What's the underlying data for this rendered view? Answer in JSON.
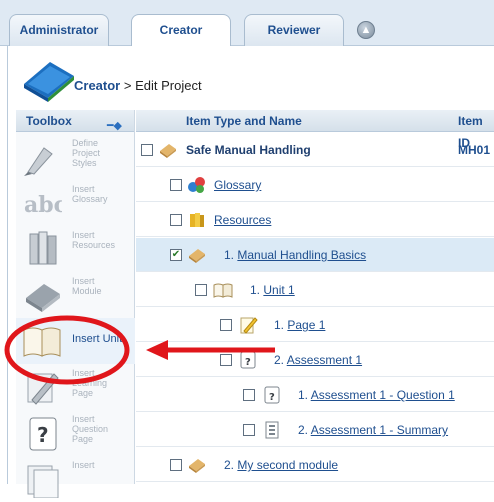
{
  "tabs": [
    {
      "label": "Administrator",
      "active": false
    },
    {
      "label": "Creator",
      "active": true
    },
    {
      "label": "Reviewer",
      "active": false
    }
  ],
  "breadcrumb": {
    "root": "Creator",
    "separator": " > ",
    "page": "Edit Project"
  },
  "toolbox": {
    "title": "Toolbox",
    "tools": [
      {
        "label": "Define Project Styles",
        "icon": "pen-nib-icon",
        "enabled": false
      },
      {
        "label": "Insert Glossary",
        "icon": "abc-glossary-icon",
        "enabled": false
      },
      {
        "label": "Insert Resources",
        "icon": "books-icon",
        "enabled": false
      },
      {
        "label": "Insert Module",
        "icon": "module-book-icon",
        "enabled": false
      },
      {
        "label": "Insert Unit",
        "icon": "open-book-icon",
        "enabled": true
      },
      {
        "label": "Insert Learning Page",
        "icon": "pencil-page-icon",
        "enabled": false
      },
      {
        "label": "Insert Question Page",
        "icon": "question-page-icon",
        "enabled": false
      },
      {
        "label": "Insert",
        "icon": "pages-icon",
        "enabled": false
      }
    ]
  },
  "grid": {
    "headers": {
      "name": "Item Type and Name",
      "id": "Item ID"
    },
    "rows": [
      {
        "name": "Safe Manual Handling",
        "id": "MH01",
        "checked": false,
        "icon": "module-book-icon"
      },
      {
        "name": "Glossary",
        "checked": false,
        "icon": "glossary-icon"
      },
      {
        "name": "Resources",
        "checked": false,
        "icon": "resources-icon"
      },
      {
        "prefix": "1.",
        "name": "Manual Handling Basics",
        "checked": true,
        "icon": "module-book-icon"
      },
      {
        "prefix": "1.",
        "name": "Unit 1",
        "checked": false,
        "icon": "open-book-icon"
      },
      {
        "prefix": "1.",
        "name": "Page 1",
        "checked": false,
        "icon": "pencil-page-icon"
      },
      {
        "prefix": "2.",
        "name": "Assessment 1",
        "checked": false,
        "icon": "question-page-icon"
      },
      {
        "prefix": "1.",
        "name": "Assessment 1 - Question 1",
        "checked": false,
        "icon": "question-page-icon"
      },
      {
        "prefix": "2.",
        "name": "Assessment 1 - Summary",
        "checked": false,
        "icon": "summary-page-icon"
      },
      {
        "prefix": "2.",
        "name": "My second module",
        "checked": false,
        "icon": "module-book-icon"
      }
    ]
  },
  "colors": {
    "accent": "#1f4f8f",
    "highlight": "#e0161b",
    "selected_row": "#dbeaf6"
  }
}
